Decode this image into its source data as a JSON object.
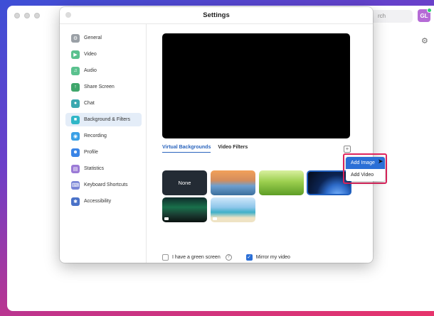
{
  "background_app": {
    "search_placeholder": "rch",
    "avatar_initials": "GL"
  },
  "settings": {
    "title": "Settings",
    "sidebar": {
      "items": [
        {
          "label": "General",
          "icon": "gear-icon",
          "color": "#9aa0a6"
        },
        {
          "label": "Video",
          "icon": "video-camera-icon",
          "color": "#5ac18e"
        },
        {
          "label": "Audio",
          "icon": "headphones-icon",
          "color": "#5ac18e"
        },
        {
          "label": "Share Screen",
          "icon": "share-screen-icon",
          "color": "#3fa66b"
        },
        {
          "label": "Chat",
          "icon": "chat-bubble-icon",
          "color": "#3aa8b0"
        },
        {
          "label": "Background & Filters",
          "icon": "background-icon",
          "color": "#2fb6c7",
          "active": true
        },
        {
          "label": "Recording",
          "icon": "recording-icon",
          "color": "#3aa0e6"
        },
        {
          "label": "Profile",
          "icon": "profile-icon",
          "color": "#3a85e6"
        },
        {
          "label": "Statistics",
          "icon": "statistics-icon",
          "color": "#9b7ad6"
        },
        {
          "label": "Keyboard Shortcuts",
          "icon": "keyboard-icon",
          "color": "#7a86d6"
        },
        {
          "label": "Accessibility",
          "icon": "accessibility-icon",
          "color": "#4a72c8"
        }
      ]
    },
    "tabs": [
      "Virtual Backgrounds",
      "Video Filters"
    ],
    "none_label": "None",
    "add_menu": [
      "Add Image",
      "Add Video"
    ],
    "green_screen_label": "I have a green screen",
    "mirror_label": "Mirror my video"
  }
}
